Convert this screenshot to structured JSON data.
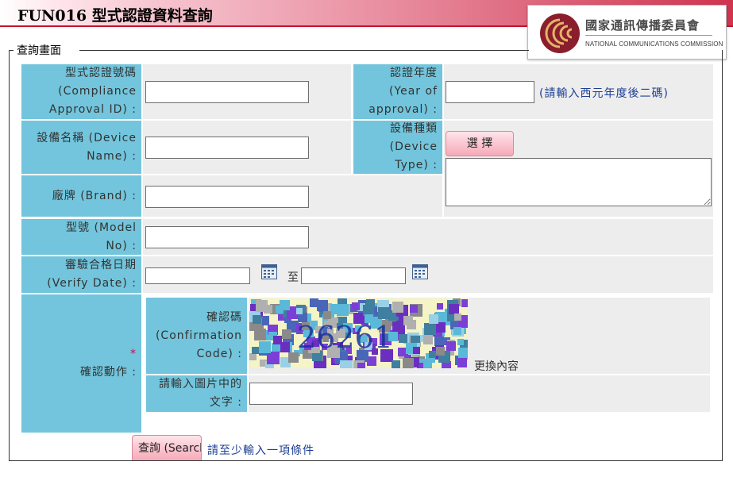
{
  "header": {
    "title": "FUN016 型式認證資料查詢",
    "logo_cn": "國家通訊傳播委員會",
    "logo_en": "NATIONAL COMMUNICATIONS COMMISSION"
  },
  "legend": "查詢畫面",
  "fields": {
    "approval_id": {
      "label_lines": [
        "型式認證號碼",
        "(Compliance",
        "Approval ID) :"
      ],
      "value": ""
    },
    "approval_year": {
      "label_lines": [
        "認證年度",
        "(Year of",
        "approval) :"
      ],
      "value": "",
      "hint": "(請輸入西元年度後二碼)"
    },
    "device_name": {
      "label_lines": [
        "設備名稱 (Device",
        "Name) :"
      ],
      "value": ""
    },
    "device_type": {
      "label_lines": [
        "設備種類",
        "(Device",
        "Type) :"
      ],
      "select_button": "選 擇",
      "value": ""
    },
    "brand": {
      "label_lines": [
        "廠牌 (Brand) :"
      ],
      "value": ""
    },
    "model": {
      "label_lines": [
        "型號 (Model",
        "No) :"
      ],
      "value": ""
    },
    "verify_date": {
      "label_lines": [
        "審驗合格日期",
        "(Verify Date) :"
      ],
      "from": "",
      "to": "",
      "separator": "至"
    }
  },
  "confirm": {
    "section_label": "確認動作 :",
    "section_star": "*",
    "code_label_lines": [
      "確認碼",
      "(Confirmation",
      "Code) :"
    ],
    "captcha_text": "26261",
    "refresh_link": "更換內容",
    "input_label_lines": [
      "請輸入圖片中的",
      "文字 :"
    ],
    "input_value": ""
  },
  "search": {
    "button_label": "查詢 (Search)",
    "hint": "請至少輸入一項條件"
  },
  "colors": {
    "label_bg": "#72c5dc",
    "value_bg": "#ededed",
    "hint_text": "#1c3f94",
    "header_accent": "#c4142f",
    "button_pink": "#f6a9b8"
  },
  "icons": [
    "calendar-icon",
    "calendar-icon"
  ]
}
